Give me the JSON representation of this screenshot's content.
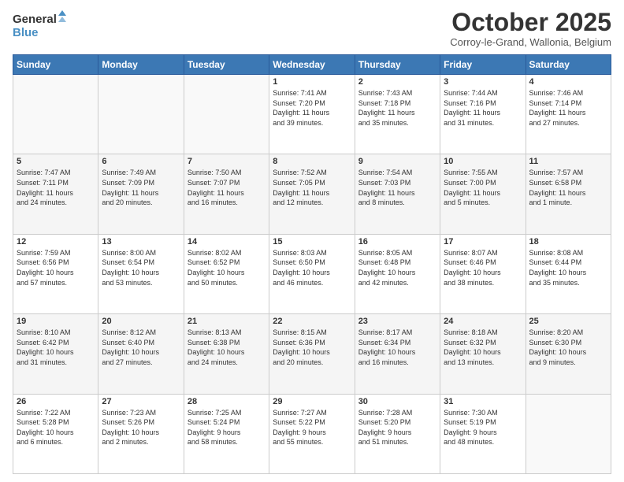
{
  "logo": {
    "line1": "General",
    "line2": "Blue"
  },
  "header": {
    "month": "October 2025",
    "location": "Corroy-le-Grand, Wallonia, Belgium"
  },
  "weekdays": [
    "Sunday",
    "Monday",
    "Tuesday",
    "Wednesday",
    "Thursday",
    "Friday",
    "Saturday"
  ],
  "weeks": [
    [
      {
        "day": "",
        "info": ""
      },
      {
        "day": "",
        "info": ""
      },
      {
        "day": "",
        "info": ""
      },
      {
        "day": "1",
        "info": "Sunrise: 7:41 AM\nSunset: 7:20 PM\nDaylight: 11 hours\nand 39 minutes."
      },
      {
        "day": "2",
        "info": "Sunrise: 7:43 AM\nSunset: 7:18 PM\nDaylight: 11 hours\nand 35 minutes."
      },
      {
        "day": "3",
        "info": "Sunrise: 7:44 AM\nSunset: 7:16 PM\nDaylight: 11 hours\nand 31 minutes."
      },
      {
        "day": "4",
        "info": "Sunrise: 7:46 AM\nSunset: 7:14 PM\nDaylight: 11 hours\nand 27 minutes."
      }
    ],
    [
      {
        "day": "5",
        "info": "Sunrise: 7:47 AM\nSunset: 7:11 PM\nDaylight: 11 hours\nand 24 minutes."
      },
      {
        "day": "6",
        "info": "Sunrise: 7:49 AM\nSunset: 7:09 PM\nDaylight: 11 hours\nand 20 minutes."
      },
      {
        "day": "7",
        "info": "Sunrise: 7:50 AM\nSunset: 7:07 PM\nDaylight: 11 hours\nand 16 minutes."
      },
      {
        "day": "8",
        "info": "Sunrise: 7:52 AM\nSunset: 7:05 PM\nDaylight: 11 hours\nand 12 minutes."
      },
      {
        "day": "9",
        "info": "Sunrise: 7:54 AM\nSunset: 7:03 PM\nDaylight: 11 hours\nand 8 minutes."
      },
      {
        "day": "10",
        "info": "Sunrise: 7:55 AM\nSunset: 7:00 PM\nDaylight: 11 hours\nand 5 minutes."
      },
      {
        "day": "11",
        "info": "Sunrise: 7:57 AM\nSunset: 6:58 PM\nDaylight: 11 hours\nand 1 minute."
      }
    ],
    [
      {
        "day": "12",
        "info": "Sunrise: 7:59 AM\nSunset: 6:56 PM\nDaylight: 10 hours\nand 57 minutes."
      },
      {
        "day": "13",
        "info": "Sunrise: 8:00 AM\nSunset: 6:54 PM\nDaylight: 10 hours\nand 53 minutes."
      },
      {
        "day": "14",
        "info": "Sunrise: 8:02 AM\nSunset: 6:52 PM\nDaylight: 10 hours\nand 50 minutes."
      },
      {
        "day": "15",
        "info": "Sunrise: 8:03 AM\nSunset: 6:50 PM\nDaylight: 10 hours\nand 46 minutes."
      },
      {
        "day": "16",
        "info": "Sunrise: 8:05 AM\nSunset: 6:48 PM\nDaylight: 10 hours\nand 42 minutes."
      },
      {
        "day": "17",
        "info": "Sunrise: 8:07 AM\nSunset: 6:46 PM\nDaylight: 10 hours\nand 38 minutes."
      },
      {
        "day": "18",
        "info": "Sunrise: 8:08 AM\nSunset: 6:44 PM\nDaylight: 10 hours\nand 35 minutes."
      }
    ],
    [
      {
        "day": "19",
        "info": "Sunrise: 8:10 AM\nSunset: 6:42 PM\nDaylight: 10 hours\nand 31 minutes."
      },
      {
        "day": "20",
        "info": "Sunrise: 8:12 AM\nSunset: 6:40 PM\nDaylight: 10 hours\nand 27 minutes."
      },
      {
        "day": "21",
        "info": "Sunrise: 8:13 AM\nSunset: 6:38 PM\nDaylight: 10 hours\nand 24 minutes."
      },
      {
        "day": "22",
        "info": "Sunrise: 8:15 AM\nSunset: 6:36 PM\nDaylight: 10 hours\nand 20 minutes."
      },
      {
        "day": "23",
        "info": "Sunrise: 8:17 AM\nSunset: 6:34 PM\nDaylight: 10 hours\nand 16 minutes."
      },
      {
        "day": "24",
        "info": "Sunrise: 8:18 AM\nSunset: 6:32 PM\nDaylight: 10 hours\nand 13 minutes."
      },
      {
        "day": "25",
        "info": "Sunrise: 8:20 AM\nSunset: 6:30 PM\nDaylight: 10 hours\nand 9 minutes."
      }
    ],
    [
      {
        "day": "26",
        "info": "Sunrise: 7:22 AM\nSunset: 5:28 PM\nDaylight: 10 hours\nand 6 minutes."
      },
      {
        "day": "27",
        "info": "Sunrise: 7:23 AM\nSunset: 5:26 PM\nDaylight: 10 hours\nand 2 minutes."
      },
      {
        "day": "28",
        "info": "Sunrise: 7:25 AM\nSunset: 5:24 PM\nDaylight: 9 hours\nand 58 minutes."
      },
      {
        "day": "29",
        "info": "Sunrise: 7:27 AM\nSunset: 5:22 PM\nDaylight: 9 hours\nand 55 minutes."
      },
      {
        "day": "30",
        "info": "Sunrise: 7:28 AM\nSunset: 5:20 PM\nDaylight: 9 hours\nand 51 minutes."
      },
      {
        "day": "31",
        "info": "Sunrise: 7:30 AM\nSunset: 5:19 PM\nDaylight: 9 hours\nand 48 minutes."
      },
      {
        "day": "",
        "info": ""
      }
    ]
  ]
}
